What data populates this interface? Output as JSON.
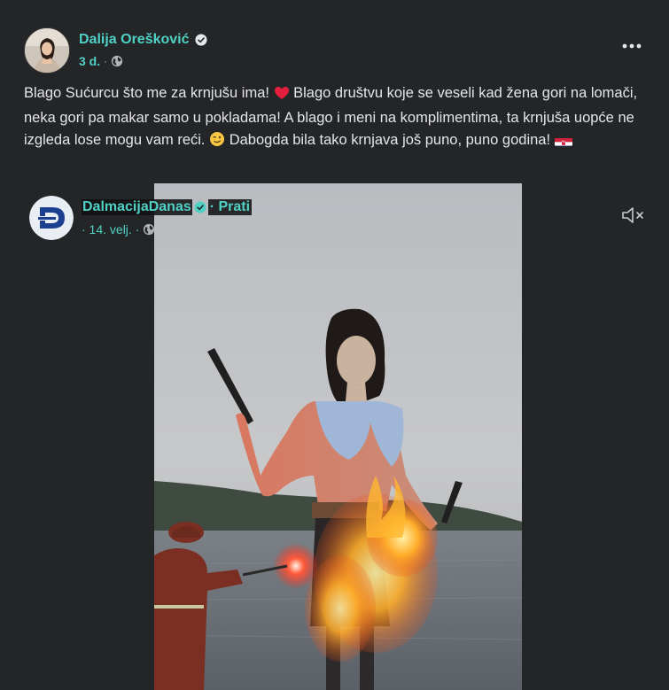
{
  "post": {
    "author_name": "Dalija Orešković",
    "time": "3 d.",
    "dot": "·",
    "text_before_heart": "Blago Sućurcu što me za krnjušu ima! ",
    "text_after_heart": " Blago društvu koje se veseli kad žena gori na lomači, neka gori pa makar samo u pokladama! A blago i meni na komplimentima, ta krnjuša uopće ne izgleda lose mogu vam reći. ",
    "text_after_wink": " Dabogda bila tako krnjava još puno, puno godina! ",
    "icons": {
      "verified": "verified-badge-icon",
      "privacy": "globe-icon",
      "more": "more-options-icon",
      "heart": "red-heart-emoji",
      "wink": "winking-face-emoji",
      "flag": "croatia-flag-emoji"
    }
  },
  "shared": {
    "page_name": "DalmacijaDanas",
    "follow_label": "· Prati",
    "date": "· 14. velj. ·",
    "icons": {
      "logo": "dalmacija-danas-logo",
      "verified": "verified-badge-icon",
      "privacy": "globe-icon",
      "mute": "sound-muted-icon"
    }
  },
  "colors": {
    "background": "#242526",
    "accent": "#4fd1c5",
    "text": "#e4e6eb",
    "secondary": "#b0b3b8",
    "heart": "#e41e3f",
    "flag_red": "#d4213d",
    "flag_white": "#ffffff",
    "flag_blue": "#171796"
  }
}
